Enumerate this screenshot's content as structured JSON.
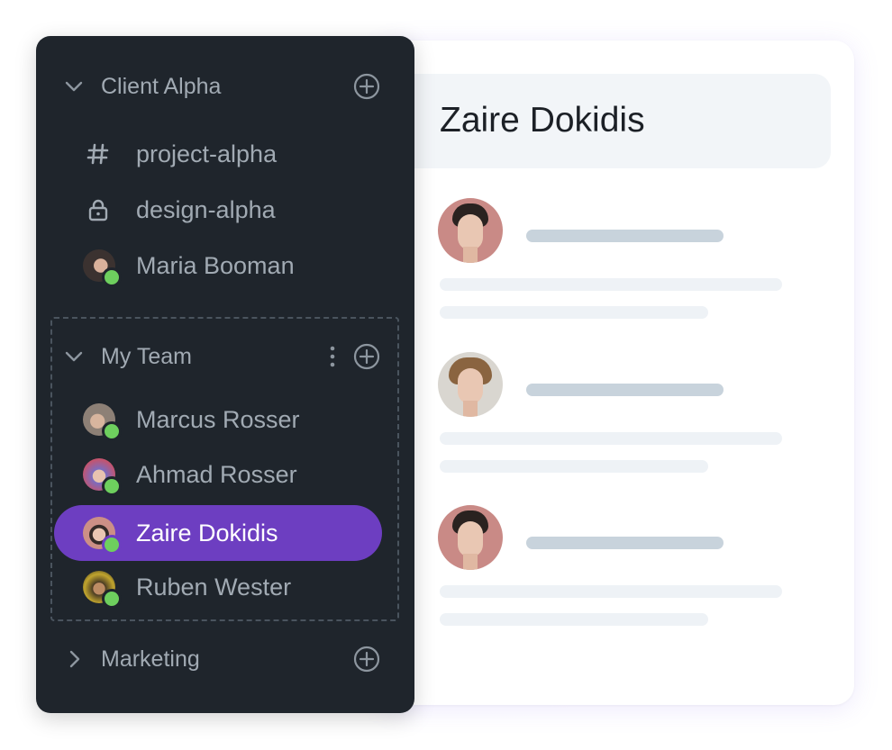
{
  "sidebar": {
    "groups": [
      {
        "label": "Client Alpha",
        "expanded": true,
        "items": [
          {
            "label": "project-alpha",
            "icon": "hash-icon"
          },
          {
            "label": "design-alpha",
            "icon": "lock-icon"
          },
          {
            "label": "Maria Booman",
            "icon": "avatar",
            "status": "online"
          }
        ]
      },
      {
        "label": "My Team",
        "expanded": true,
        "items": [
          {
            "label": "Marcus Rosser",
            "icon": "avatar",
            "status": "online"
          },
          {
            "label": "Ahmad Rosser",
            "icon": "avatar",
            "status": "online"
          },
          {
            "label": "Zaire Dokidis",
            "icon": "avatar",
            "status": "online",
            "selected": true
          },
          {
            "label": "Ruben Wester",
            "icon": "avatar",
            "status": "online"
          }
        ]
      },
      {
        "label": "Marketing",
        "expanded": false,
        "items": []
      }
    ]
  },
  "conversation": {
    "title": "Zaire Dokidis",
    "messages": 3
  },
  "colors": {
    "sidebar_bg": "#1f252c",
    "selected_bg": "#6d3ec1",
    "online_status": "#6ecf5e",
    "header_bg": "#f2f5f8",
    "placeholder_bar": "#c8d3dc"
  }
}
